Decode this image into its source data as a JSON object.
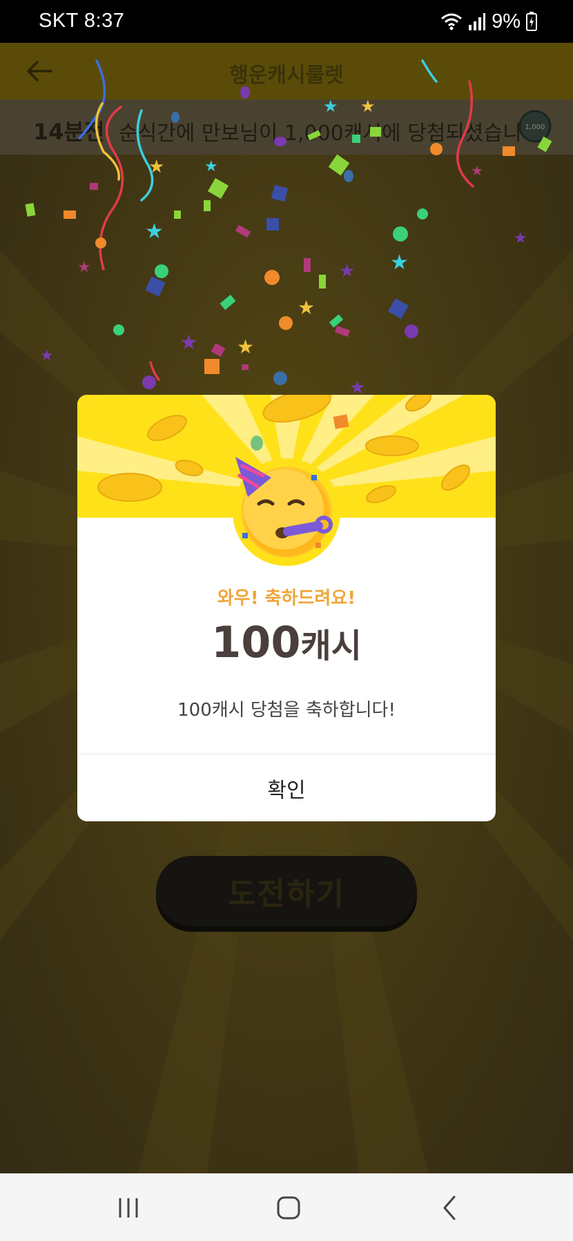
{
  "status_bar": {
    "carrier_time": "SKT 8:37",
    "battery": "9%"
  },
  "app_bar": {
    "title": "행운캐시룰렛"
  },
  "ticker": {
    "time_ago": "14분전",
    "message": "순식간에 만보님이 1,000캐시에 당첨되셨습니다!",
    "coin_label": "1,000"
  },
  "challenge_button": {
    "label": "도전하기"
  },
  "modal": {
    "congrats": "와우! 축하드려요!",
    "amount_number": "100",
    "amount_unit": "캐시",
    "description": "100캐시 당첨을 축하합니다!",
    "confirm_label": "확인"
  },
  "colors": {
    "hero_yellow": "#ffe11a",
    "congrats_orange": "#f0a53a",
    "amount_brown": "#4a3f3c"
  },
  "icons": [
    "back-arrow-icon",
    "wifi-icon",
    "signal-icon",
    "battery-icon",
    "party-emoji-icon",
    "recents-icon",
    "home-icon",
    "nav-back-icon"
  ]
}
